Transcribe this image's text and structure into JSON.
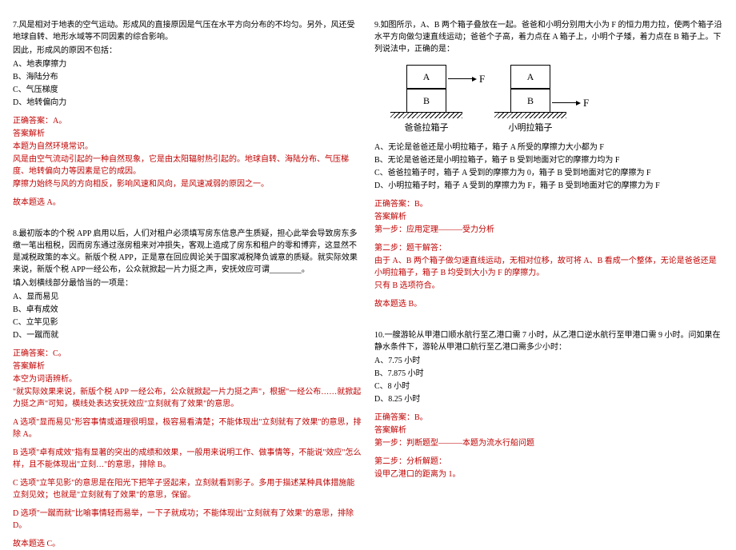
{
  "left": {
    "q7": {
      "stem1": "7.风是相对于地表的空气运动。形成风的直接原因是气压在水平方向分布的不均匀。另外，风还受地球自转、地形水域等不同因素的综合影响。",
      "stem2": "因此，形成风的原因不包括：",
      "opts": [
        "A、地表摩擦力",
        "B、海陆分布",
        "C、气压梯度",
        "D、地转偏向力"
      ],
      "ans": "正确答案：A。",
      "a1": "答案解析",
      "a2": "本题为自然环境常识。",
      "a3": "风是由空气流动引起的一种自然现象，它是由太阳辐射热引起的。地球自转、海陆分布、气压梯度、地转偏向力等因素是它的成因。",
      "a4": "摩擦力始终与风的方向相反，影响风速和风向，是风速减弱的原因之一。",
      "a5": "故本题选 A。"
    },
    "q8": {
      "stem1": "8.最初版本的个税 APP 启用以后，人们对租户必须填写房东信息产生质疑，担心此举会导致房东多缴一笔出租税，因而房东通过涨房租来对冲损失，客观上造成了房东和租户的零和博弈，这显然不是减税政策的本义。新版个税 APP，正是意在回应舆论关于国家减税降负诚意的质疑。就实际效果来说，新版个税 APP一经公布，公众就掀起一片力挺之声，安抚效应可谓________。",
      "stem2": "填入划横线部分最恰当的一项是：",
      "opts": [
        "A、显而易见",
        "B、卓有成效",
        "C、立竿见影",
        "D、一蹴而就"
      ],
      "ans": "正确答案：C。",
      "a1": "答案解析",
      "a2": "本空为词语辨析。",
      "a3": "\"就实际效果来说，新版个税 APP 一经公布，公众就掀起一片力挺之声\"，根据\"一经公布……就掀起力挺之声\"可知，横线处表达安抚效应\"立刻就有了效果\"的意思。",
      "a4": "A 选项\"显而易见\"形容事情或道理很明显，极容易看清楚；不能体现出\"立刻就有了效果\"的意思，排除 A。",
      "a5": "B 选项\"卓有成效\"指有显著的突出的成绩和效果，一般用来说明工作、做事情等，不能说\"效应\"怎么样，且不能体现出\"立刻…\"的意思，排除 B。",
      "a6": "C 选项\"立竿见影\"的意思是在阳光下把竿子竖起来，立刻就看到影子。多用于描述某种具体措施能立刻见效；也就是\"立刻就有了效果\"的意思，保留。",
      "a7": "D 选项\"一蹴而就\"比喻事情轻而易举，一下子就成功；不能体现出\"立刻就有了效果\"的意思，排除 D。",
      "a8": "故本题选 C。"
    }
  },
  "right": {
    "q9": {
      "stem1": "9.如图所示，A、B 两个箱子叠放在一起。爸爸和小明分别用大小为 F 的恒力用力拉，使两个箱子沿水平方向做匀速直线运动；爸爸个子高，着力点在 A 箱子上，小明个子矮，着力点在 B 箱子上。下列说法中，正确的是：",
      "diag": {
        "boxA": "A",
        "boxB": "B",
        "force": "F",
        "label1": "爸爸拉箱子",
        "label2": "小明拉箱子"
      },
      "opts": [
        "A、无论是爸爸还是小明拉箱子，箱子 A 所受的摩擦力大小都为 F",
        "B、无论是爸爸还是小明拉箱子，箱子 B 受到地面对它的摩擦力均为 F",
        "C、爸爸拉箱子时，箱子 A 受到的摩擦力为 0，箱子 B 受到地面对它的摩擦为 F",
        "D、小明拉箱子时，箱子 A 受到的摩擦力为 F，箱子 B 受到地面对它的摩擦力为 F"
      ],
      "ans": "正确答案：B。",
      "a1": "答案解析",
      "a2": "第一步：应用定理———受力分析",
      "a3": "第二步：题干解答：",
      "a4": "由于 A、B 两个箱子做匀速直线运动，无相对位移，故可将 A、B 看成一个整体，无论是爸爸还是小明拉箱子，箱子 B 均受到大小为 F 的摩擦力。",
      "a5": "只有 B 选项符合。",
      "a6": "故本题选 B。"
    },
    "q10": {
      "stem1": "10.一艘游轮从甲港口顺水航行至乙港口需 7 小时，从乙港口逆水航行至甲港口需 9 小时。问如果在静水条件下，游轮从甲港口航行至乙港口需多少小时：",
      "opts": [
        "A、7.75 小时",
        "B、7.875 小时",
        "C、8 小时",
        "D、8.25 小时"
      ],
      "ans": "正确答案：B。",
      "a1": "答案解析",
      "a2": "第一步：判断题型———本题为流水行船问题",
      "a3": "第二步：分析解题：",
      "a4": "设甲乙港口的距离为 1。"
    }
  }
}
